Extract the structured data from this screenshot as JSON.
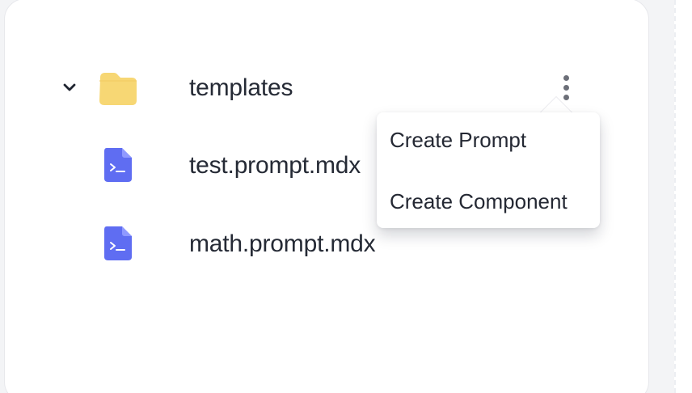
{
  "explorer": {
    "items": [
      {
        "label": "templates",
        "type": "folder",
        "icon": "folder-icon",
        "expanded": true,
        "expand_icon": "chevron-down-icon",
        "actions_icon": "more-vertical-icon"
      },
      {
        "label": "test.prompt.mdx",
        "type": "file",
        "icon": "prompt-file-icon"
      },
      {
        "label": "math.prompt.mdx",
        "type": "file",
        "icon": "prompt-file-icon"
      }
    ]
  },
  "context_menu": {
    "items": [
      {
        "label": "Create Prompt"
      },
      {
        "label": "Create Component"
      }
    ]
  },
  "colors": {
    "folder": "#f7d774",
    "file": "#5f6df2",
    "text": "#252a35",
    "more_dots": "#6c6f78"
  }
}
